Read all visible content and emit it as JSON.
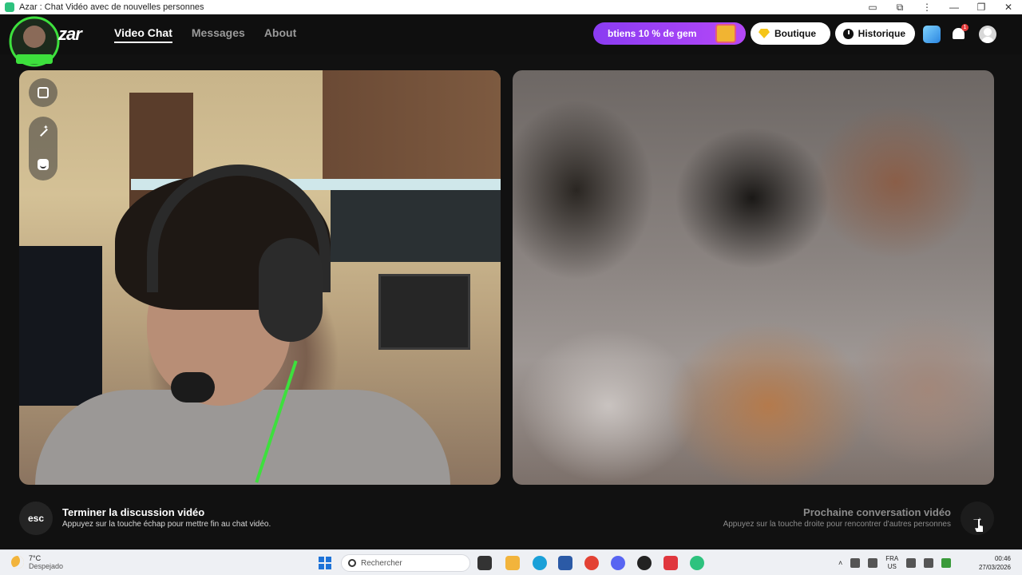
{
  "window": {
    "title": "Azar : Chat Vidéo avec de nouvelles personnes",
    "controls": [
      "video-icon",
      "extension-icon",
      "more-icon",
      "minimize",
      "maximize",
      "close"
    ]
  },
  "header": {
    "logo_text": "zar",
    "nav": [
      {
        "label": "Video Chat",
        "active": true
      },
      {
        "label": "Messages",
        "active": false
      },
      {
        "label": "About",
        "active": false
      }
    ],
    "promo_text": "btiens 10 % de gem",
    "boutique_label": "Boutique",
    "historique_label": "Historique",
    "notification_count": "1"
  },
  "video": {
    "local_tools": [
      "swap-camera-icon",
      "effects-wand-icon",
      "sticker-face-icon"
    ],
    "remote_state": "blurred"
  },
  "footer": {
    "esc_key": "esc",
    "end_title": "Terminer la discussion vidéo",
    "end_subtitle": "Appuyez sur la touche échap pour mettre fin au chat vidéo.",
    "next_title": "Prochaine conversation vidéo",
    "next_subtitle": "Appuyez sur la touche droite pour rencontrer d'autres personnes",
    "next_icon": "→"
  },
  "taskbar": {
    "weather_temp": "7°C",
    "weather_desc": "Despejado",
    "search_placeholder": "Rechercher",
    "lang_top": "FRA",
    "lang_bottom": "US",
    "time": "00:46",
    "date": "27/03/2026",
    "apps_colors": [
      "#333333",
      "#f2b43c",
      "#1aa0d8",
      "#2b5aa6",
      "#e34234",
      "#5865f2",
      "#222222",
      "#e0373e",
      "#2ec27e"
    ]
  }
}
